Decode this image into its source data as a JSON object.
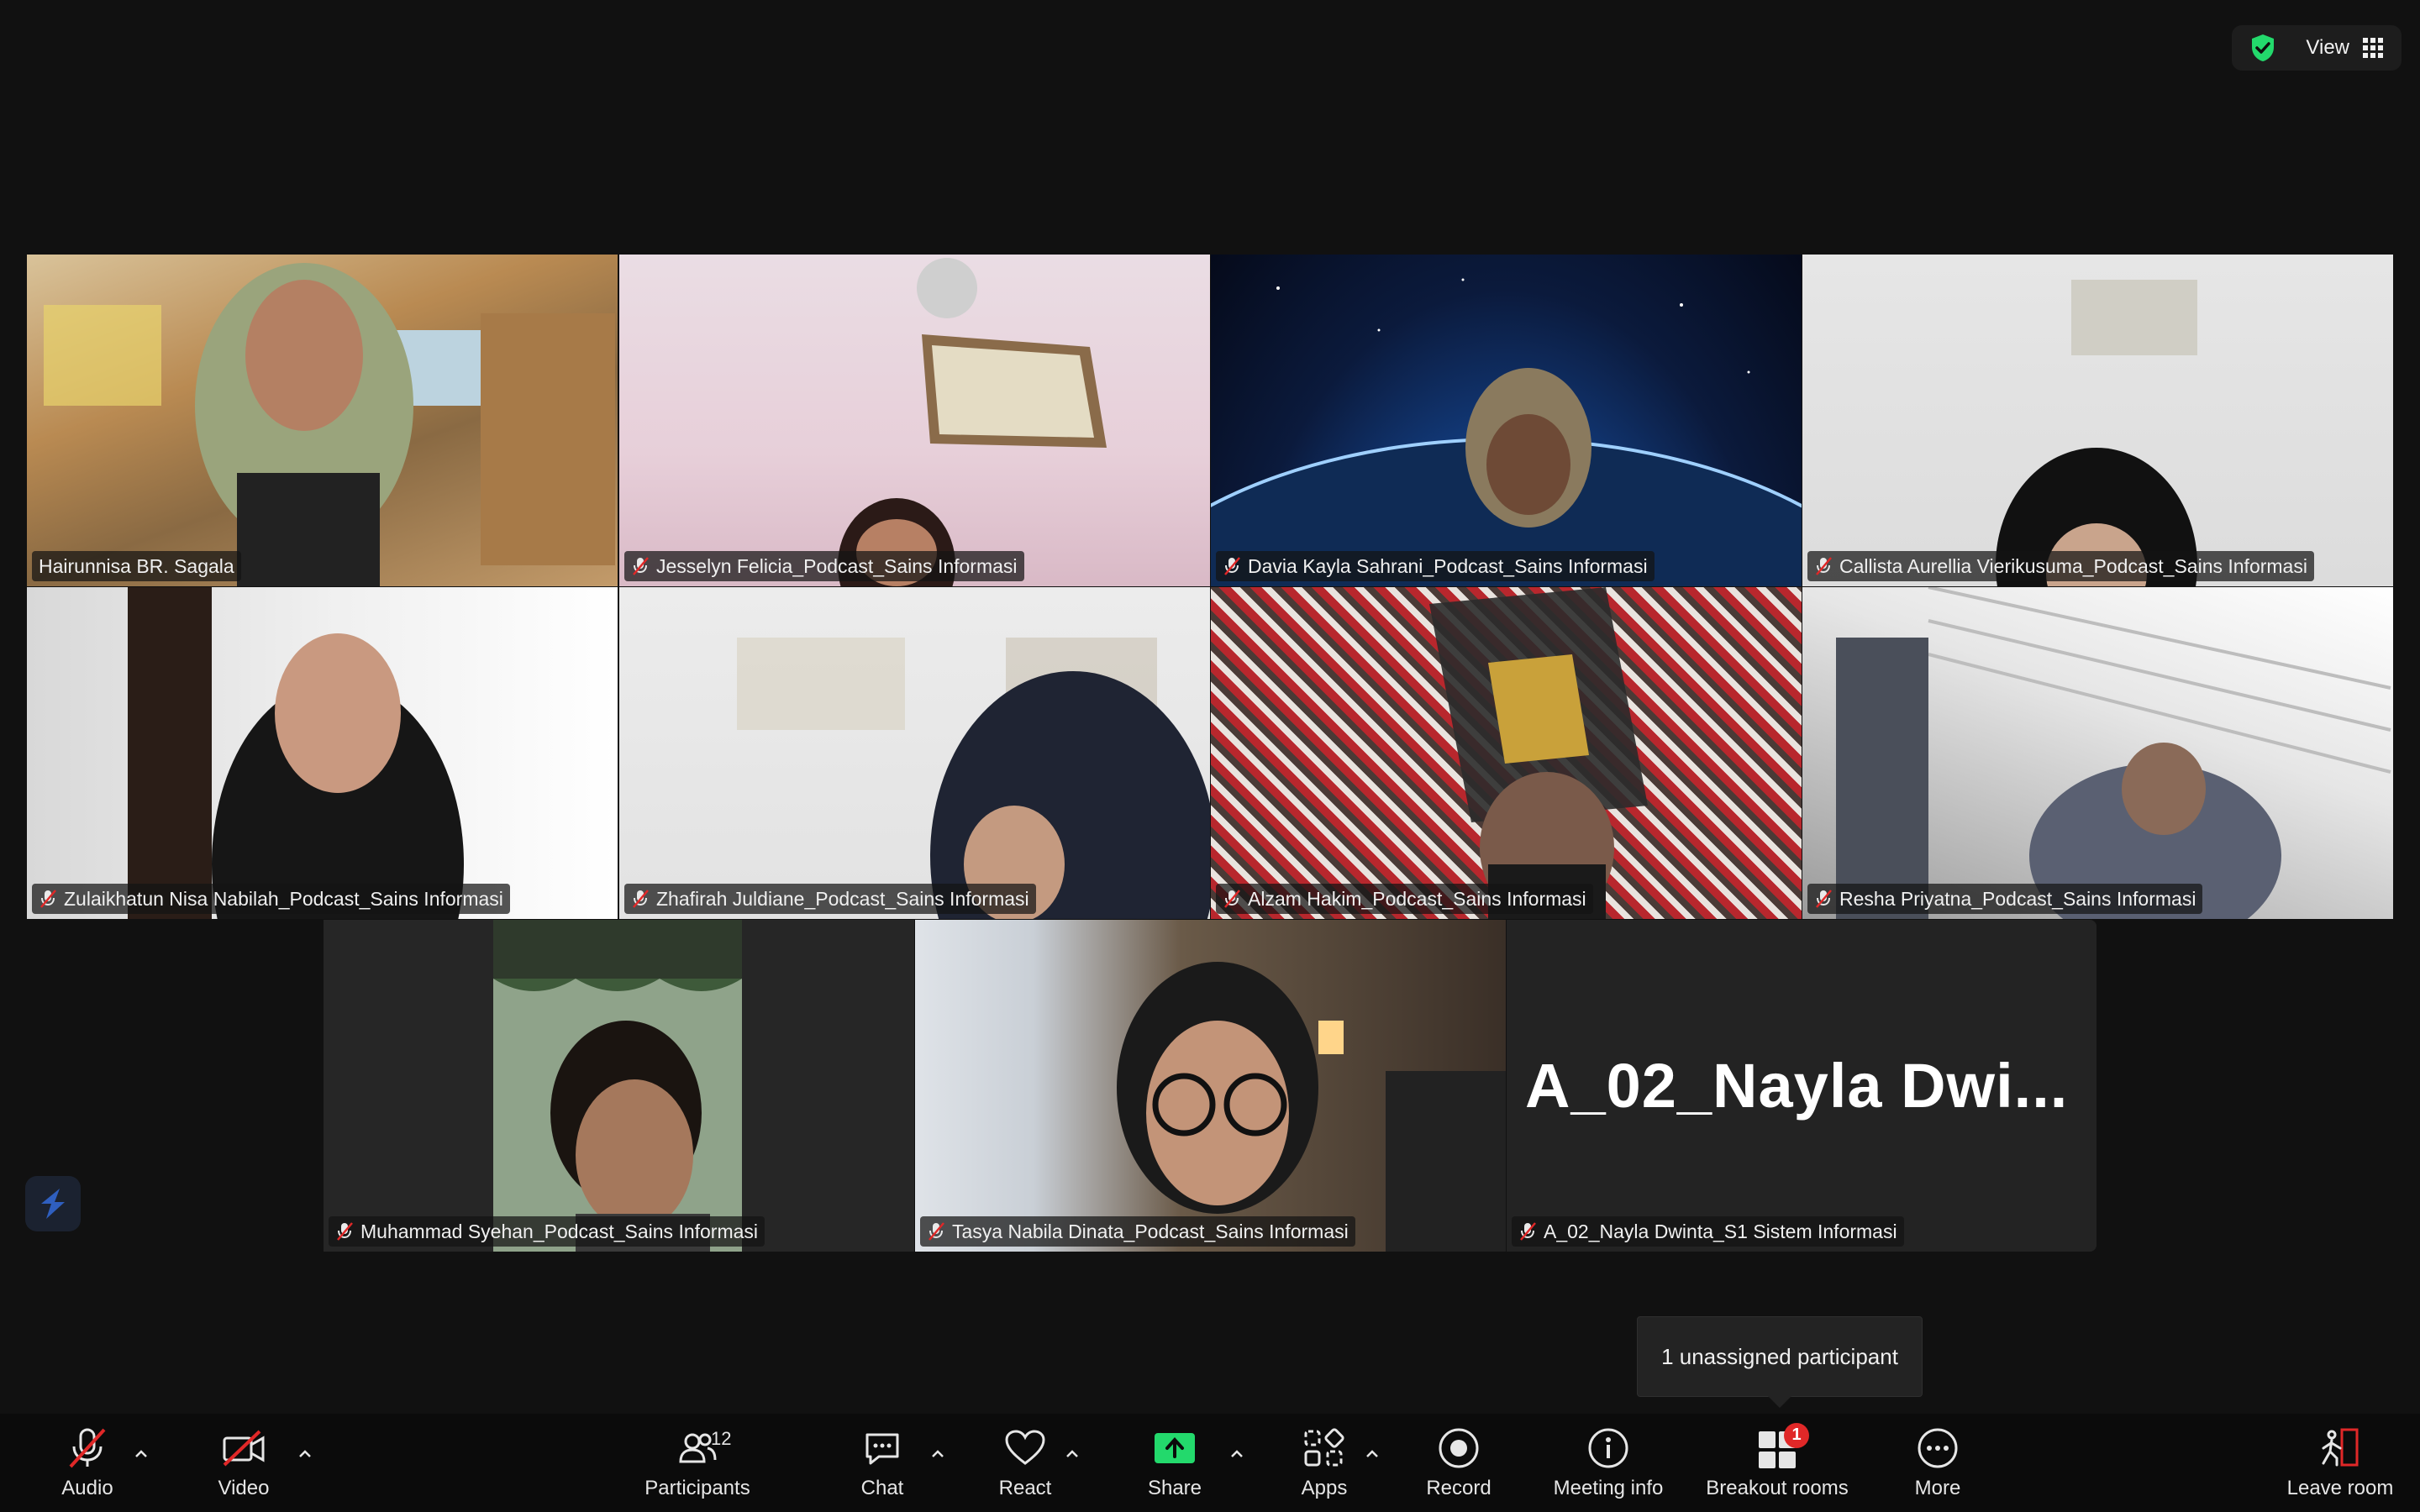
{
  "window": {
    "view_label": "View",
    "security_icon": "shield-check-icon"
  },
  "participants": [
    {
      "name": "Hairunnisa BR. Sagala",
      "muted": false,
      "active": true
    },
    {
      "name": "Jesselyn Felicia_Podcast_Sains Informasi",
      "muted": true
    },
    {
      "name": "Davia Kayla Sahrani_Podcast_Sains Informasi",
      "muted": true
    },
    {
      "name": "Callista Aurellia Vierikusuma_Podcast_Sains Informasi",
      "muted": true
    },
    {
      "name": "Zulaikhatun Nisa Nabilah_Podcast_Sains Informasi",
      "muted": true
    },
    {
      "name": "Zhafirah Juldiane_Podcast_Sains Informasi",
      "muted": true
    },
    {
      "name": "Alzam Hakim_Podcast_Sains Informasi",
      "muted": true
    },
    {
      "name": "Resha Priyatna_Podcast_Sains Informasi",
      "muted": true
    },
    {
      "name": "Muhammad Syehan_Podcast_Sains Informasi",
      "muted": true
    },
    {
      "name": "Tasya Nabila Dinata_Podcast_Sains Informasi",
      "muted": true
    },
    {
      "name": "A_02_Nayla Dwinta_S1 Sistem Informasi",
      "muted": true,
      "display_text": "A_02_Nayla  Dwi..."
    }
  ],
  "tooltip": {
    "text": "1 unassigned participant"
  },
  "toolbar": {
    "audio": "Audio",
    "video": "Video",
    "participants": "Participants",
    "participants_count": "12",
    "chat": "Chat",
    "react": "React",
    "share": "Share",
    "apps": "Apps",
    "record": "Record",
    "meeting_info": "Meeting info",
    "breakout_rooms": "Breakout rooms",
    "breakout_badge": "1",
    "more": "More",
    "leave_room": "Leave room"
  },
  "colors": {
    "background": "#111111",
    "toolbar": "#0b0b0b",
    "active_speaker": "#23d96c",
    "share_green": "#23d96c",
    "muted_red": "#e02828"
  }
}
